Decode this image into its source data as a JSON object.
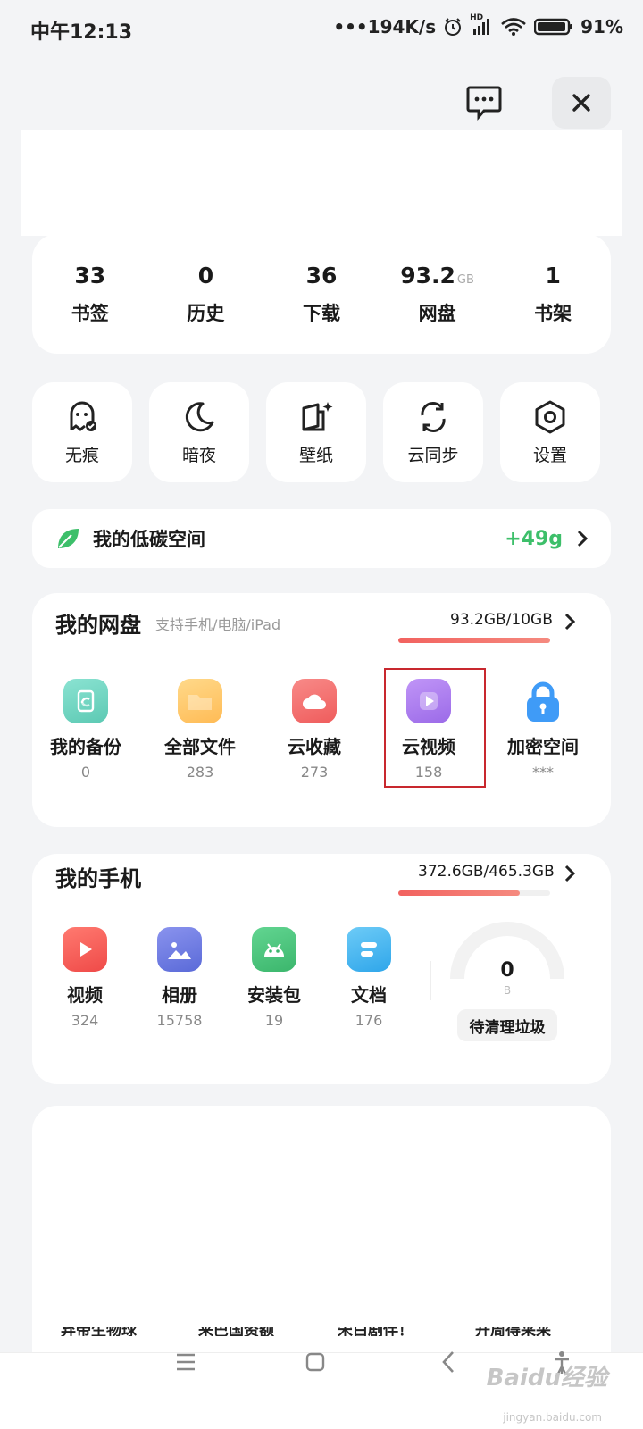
{
  "status_bar": {
    "time": "中午12:13",
    "speed": "•••194K/s",
    "battery": "91%",
    "network_badge": "HD"
  },
  "stats": [
    {
      "value": "33",
      "unit": "",
      "label": "书签"
    },
    {
      "value": "0",
      "unit": "",
      "label": "历史"
    },
    {
      "value": "36",
      "unit": "",
      "label": "下载"
    },
    {
      "value": "93.2",
      "unit": "GB",
      "label": "网盘"
    },
    {
      "value": "1",
      "unit": "",
      "label": "书架"
    }
  ],
  "tools": [
    {
      "label": "无痕",
      "icon": "ghost-icon"
    },
    {
      "label": "暗夜",
      "icon": "moon-icon"
    },
    {
      "label": "壁纸",
      "icon": "wallpaper-icon"
    },
    {
      "label": "云同步",
      "icon": "sync-icon"
    },
    {
      "label": "设置",
      "icon": "gear-icon"
    }
  ],
  "low_carbon": {
    "label": "我的低碳空间",
    "value": "+49g",
    "accent": "#3dbf6a"
  },
  "cloud_disk": {
    "title": "我的网盘",
    "subtitle": "支持手机/电脑/iPad",
    "usage": "93.2GB/10GB",
    "usage_fraction": 1.0,
    "items": [
      {
        "label": "我的备份",
        "count": "0",
        "icon": "backup-icon",
        "color": "#7ad8c8"
      },
      {
        "label": "全部文件",
        "count": "283",
        "icon": "folder-icon",
        "color": "#ffc56a"
      },
      {
        "label": "云收藏",
        "count": "273",
        "icon": "cloud-collect-icon",
        "color": "#f36b6b"
      },
      {
        "label": "云视频",
        "count": "158",
        "icon": "video-play-icon",
        "color": "#a979f0"
      },
      {
        "label": "加密空间",
        "count": "***",
        "icon": "lock-icon",
        "color": "#3f9bf7"
      }
    ]
  },
  "my_phone": {
    "title": "我的手机",
    "usage": "372.6GB/465.3GB",
    "usage_fraction": 0.8,
    "items": [
      {
        "label": "视频",
        "count": "324",
        "icon": "video-icon",
        "color": "#f25a55"
      },
      {
        "label": "相册",
        "count": "15758",
        "icon": "album-icon",
        "color": "#6f7fe6"
      },
      {
        "label": "安装包",
        "count": "19",
        "icon": "android-icon",
        "color": "#45c27a"
      },
      {
        "label": "文档",
        "count": "176",
        "icon": "document-icon",
        "color": "#3cb2f0"
      }
    ],
    "junk_value": "0",
    "junk_unit": "B",
    "junk_button": "待清理垃圾"
  },
  "cut_texts": [
    "弃帝生物球",
    "来巴国资额",
    "宋白剧伴！",
    "开周得采采"
  ],
  "watermark": {
    "main": "Baidu经验",
    "sub": "jingyan.baidu.com"
  }
}
